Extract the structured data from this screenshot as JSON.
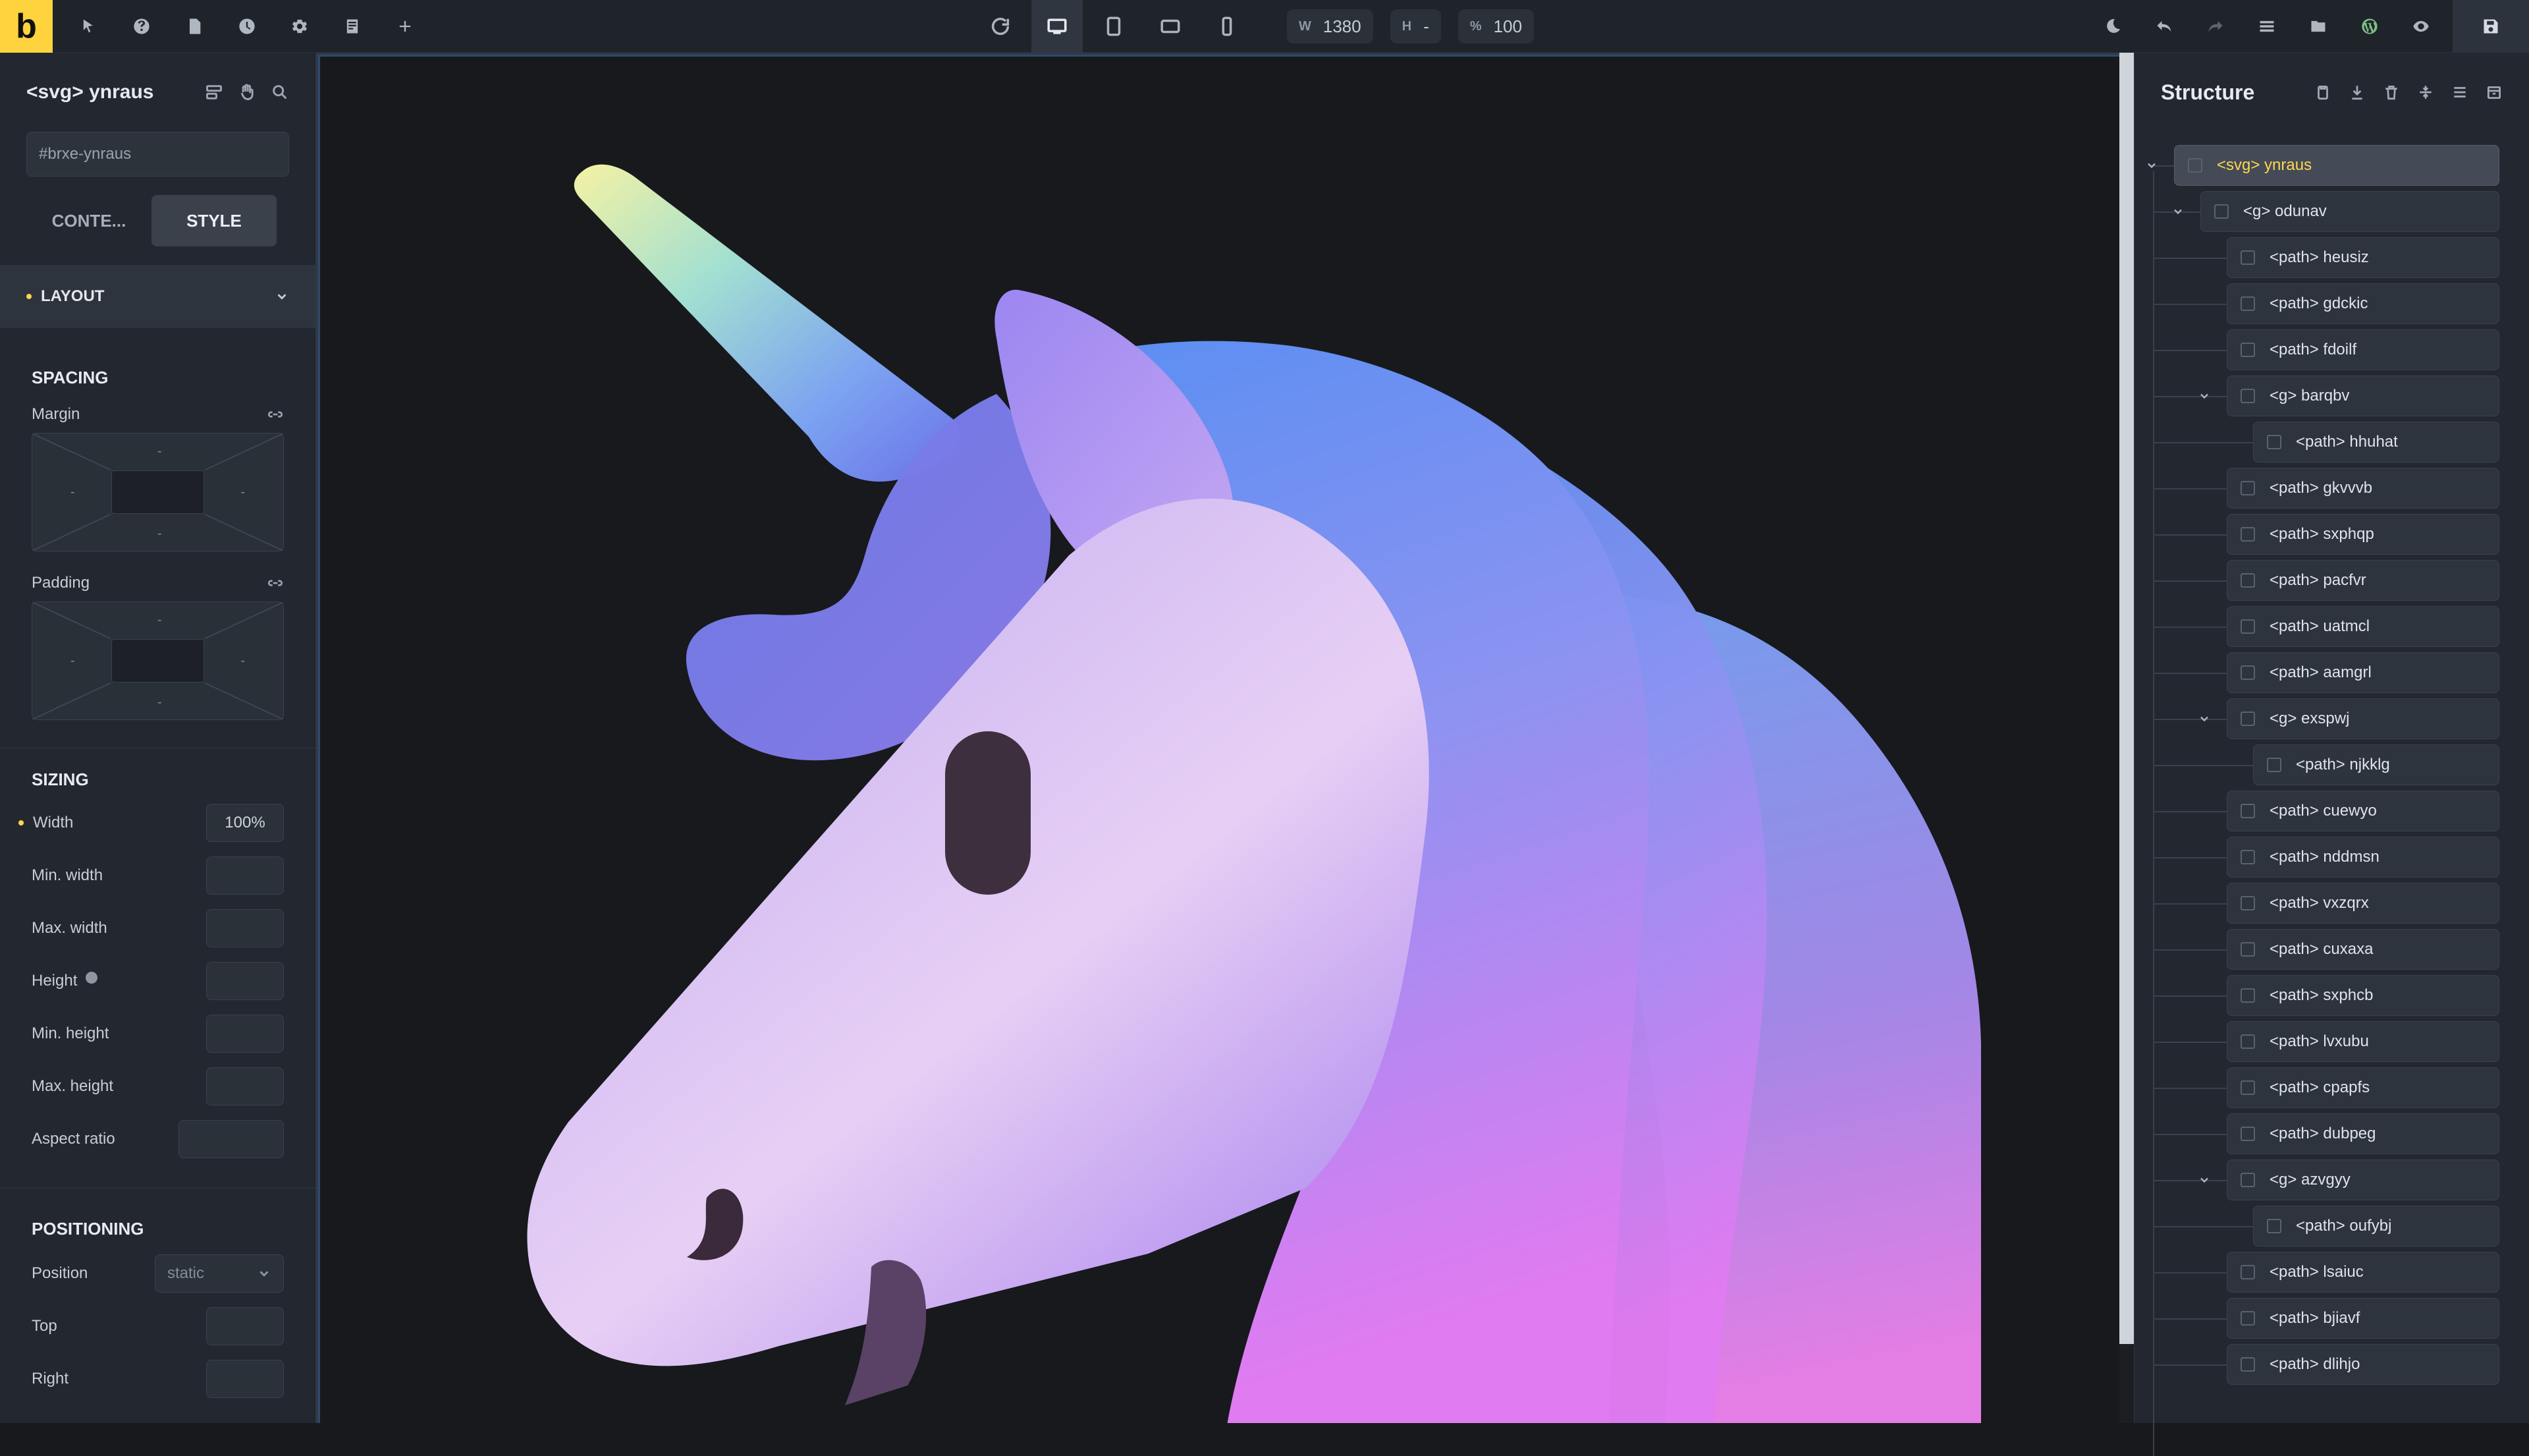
{
  "topbar": {
    "brand": "b",
    "left_icons": [
      "cursor-icon",
      "help-icon",
      "page-icon",
      "history-icon",
      "settings-icon",
      "template-icon",
      "plus-icon"
    ],
    "device_icons": [
      "refresh-icon",
      "desktop-icon",
      "tablet-portrait-icon",
      "tablet-landscape-icon",
      "mobile-icon"
    ],
    "width_label": "W",
    "width_value": "1380",
    "height_label": "H",
    "height_value": "-",
    "zoom_label": "%",
    "zoom_value": "100",
    "right_icons": [
      "moon-icon",
      "undo-icon",
      "redo-icon",
      "menu-icon",
      "folder-icon",
      "wordpress-icon",
      "eye-icon",
      "save-icon"
    ]
  },
  "left_panel": {
    "title": "<svg> ynraus",
    "id_placeholder": "#brxe-ynraus",
    "tabs": [
      "CONTE...",
      "STYLE"
    ],
    "layout_label": "LAYOUT",
    "spacing_title": "SPACING",
    "margin_label": "Margin",
    "padding_label": "Padding",
    "dash": "-",
    "sizing_title": "SIZING",
    "width_label": "Width",
    "width_value": "100%",
    "min_width_label": "Min. width",
    "max_width_label": "Max. width",
    "height_label": "Height",
    "min_height_label": "Min. height",
    "max_height_label": "Max. height",
    "aspect_ratio_label": "Aspect ratio",
    "positioning_title": "POSITIONING",
    "position_label": "Position",
    "position_value": "static",
    "top_label": "Top",
    "right_label": "Right"
  },
  "structure": {
    "title": "Structure",
    "items": [
      {
        "label": "<svg> ynraus",
        "level": 0,
        "caret": true,
        "selected": true
      },
      {
        "label": "<g> odunav",
        "level": 1,
        "caret": true
      },
      {
        "label": "<path> heusiz",
        "level": 2
      },
      {
        "label": "<path> gdckic",
        "level": 2
      },
      {
        "label": "<path> fdoilf",
        "level": 2
      },
      {
        "label": "<g> barqbv",
        "level": 2,
        "caret": true
      },
      {
        "label": "<path> hhuhat",
        "level": 3
      },
      {
        "label": "<path> gkvvvb",
        "level": 2
      },
      {
        "label": "<path> sxphqp",
        "level": 2
      },
      {
        "label": "<path> pacfvr",
        "level": 2
      },
      {
        "label": "<path> uatmcl",
        "level": 2
      },
      {
        "label": "<path> aamgrl",
        "level": 2
      },
      {
        "label": "<g> exspwj",
        "level": 2,
        "caret": true
      },
      {
        "label": "<path> njkklg",
        "level": 3
      },
      {
        "label": "<path> cuewyo",
        "level": 2
      },
      {
        "label": "<path> nddmsn",
        "level": 2
      },
      {
        "label": "<path> vxzqrx",
        "level": 2
      },
      {
        "label": "<path> cuxaxa",
        "level": 2
      },
      {
        "label": "<path> sxphcb",
        "level": 2
      },
      {
        "label": "<path> lvxubu",
        "level": 2
      },
      {
        "label": "<path> cpapfs",
        "level": 2
      },
      {
        "label": "<path> dubpeg",
        "level": 2
      },
      {
        "label": "<g> azvgyy",
        "level": 2,
        "caret": true
      },
      {
        "label": "<path> oufybj",
        "level": 3
      },
      {
        "label": "<path> lsaiuc",
        "level": 2
      },
      {
        "label": "<path> bjiavf",
        "level": 2
      },
      {
        "label": "<path> dlihjo",
        "level": 2
      }
    ]
  },
  "colors": {
    "brand": "#ffd33d",
    "accent": "#ffd64f",
    "canvas": "#17191d",
    "panel": "#232830"
  }
}
